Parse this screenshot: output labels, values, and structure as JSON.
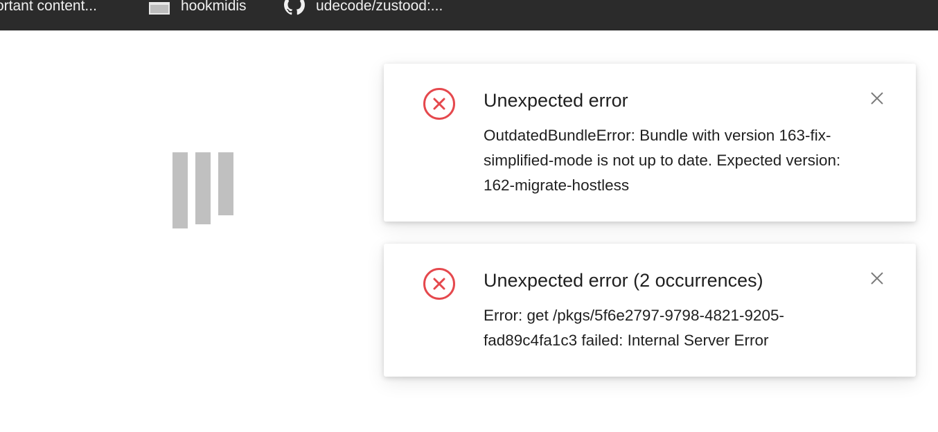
{
  "bookmarks_bar": {
    "items": [
      {
        "label": "ortant content...",
        "icon": ""
      },
      {
        "label": "hookmidis",
        "icon": "folder-icon"
      },
      {
        "label": "udecode/zustood:...",
        "icon": "github-icon"
      }
    ]
  },
  "loader": {
    "icon": "loading-bars-icon",
    "color": "#c0c0c0"
  },
  "toasts": [
    {
      "title": "Unexpected error",
      "message": "OutdatedBundleError: Bundle with version 163-fix-simplified-mode is not up to date. Expected version: 162-migrate-hostless",
      "icon": "error-circle-icon",
      "close_icon": "close-icon"
    },
    {
      "title": "Unexpected error (2 occurrences)",
      "message": "Error: get /pkgs/5f6e2797-9798-4821-9205-fad89c4fa1c3 failed: Internal Server Error",
      "icon": "error-circle-icon",
      "close_icon": "close-icon"
    }
  ],
  "colors": {
    "error": "#e5484d",
    "text": "#1f1f1f",
    "bookmarks_bg": "#2b2b2b",
    "close": "#7a7a7a"
  }
}
